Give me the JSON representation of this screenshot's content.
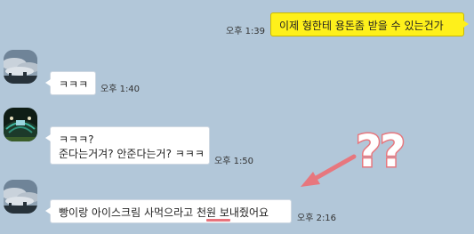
{
  "colors": {
    "background": "#b2c7d9",
    "sent_bubble": "#fef01b",
    "recv_bubble": "#ffffff",
    "annotation": "#e7777e"
  },
  "messages": [
    {
      "side": "sent",
      "text": "이제 형한테 용돈좀 받을 수 있는건가",
      "time": "오후 1:39"
    },
    {
      "side": "recv",
      "text": "ㅋㅋㅋ",
      "time": "오후 1:40",
      "avatar": "sky-clouds-avatar"
    },
    {
      "side": "recv",
      "lines": [
        "ㅋㅋㅋ?",
        "준다는거겨? 안준다는거? ㅋㅋㅋ"
      ],
      "time": "오후 1:50",
      "avatar": "stadium-avatar"
    },
    {
      "side": "recv",
      "text_before": "빵이랑 아이스크림 사먹으라고 ",
      "text_emph": "천원",
      "text_after": " 보내줬어요",
      "time": "오후 2:16",
      "avatar": "sky-clouds-avatar"
    }
  ],
  "annotation": {
    "text": "??",
    "icon": "arrow-icon"
  }
}
